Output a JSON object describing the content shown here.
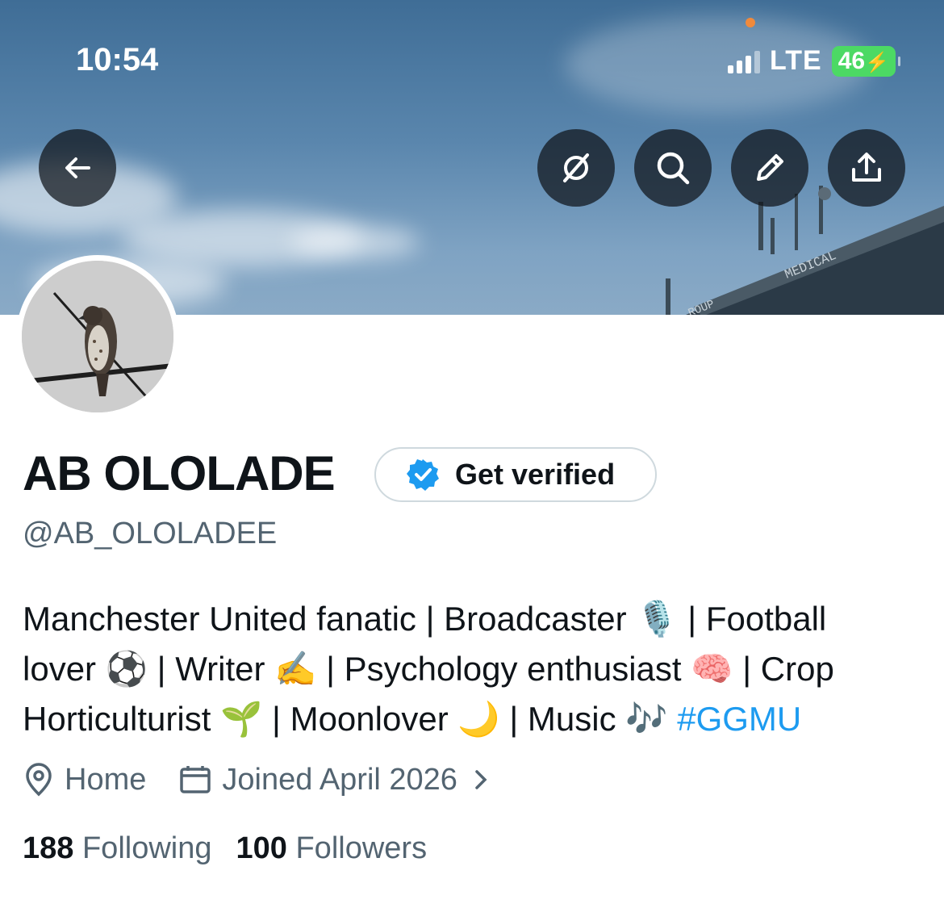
{
  "status_bar": {
    "time": "10:54",
    "network": "LTE",
    "battery": "46",
    "battery_color": "#4cd964"
  },
  "header_actions": {
    "back": "back-arrow-icon",
    "grok": "grok-icon",
    "search": "search-icon",
    "edit": "pencil-icon",
    "share": "share-icon"
  },
  "profile": {
    "name": "AB OLOLADE",
    "verify_button": "Get verified",
    "handle": "@AB_OLOLADEE",
    "bio_lines": [
      "Manchester United fanatic | Broadcaster 🎙️ | Football",
      "lover ⚽ | Writer ✍️ | Psychology enthusiast 🧠 | Crop",
      "Horticulturist 🌱 | Moonlover 🌙 | Music 🎶 "
    ],
    "hashtag": "#GGMU",
    "location": "Home",
    "joined": "Joined April 2026",
    "following_count": "188",
    "following_label": "Following",
    "followers_count": "100",
    "followers_label": "Followers"
  },
  "colors": {
    "link": "#1d9bf0",
    "secondary_text": "#536471",
    "primary_text": "#0f1419"
  }
}
